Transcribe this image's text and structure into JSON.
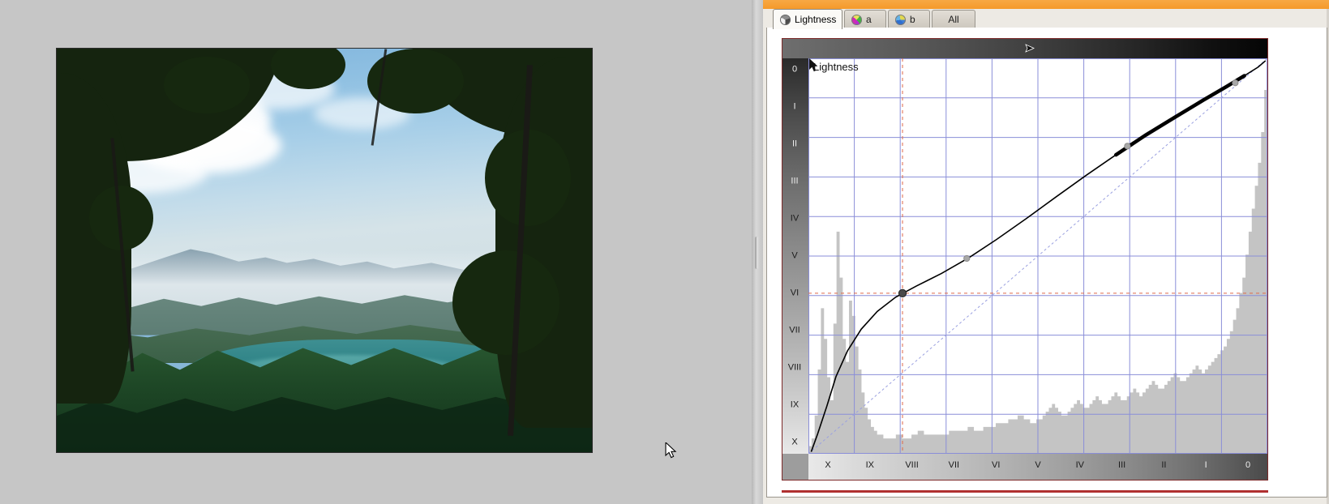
{
  "window": {
    "accent_color": "#f59a2b",
    "canvas_background": "#c6c6c6"
  },
  "image_view": {
    "name": "photo-canvas",
    "description": "Landscape photograph of a lake surrounded by forested hills, framed by dark tree foliage"
  },
  "tabs": [
    {
      "id": "lightness",
      "label": "Lightness",
      "icon": "lightness-wheel-icon",
      "active": true
    },
    {
      "id": "a",
      "label": "a",
      "icon": "a-channel-wheel-icon",
      "active": false
    },
    {
      "id": "b",
      "label": "b",
      "icon": "b-channel-wheel-icon",
      "active": false
    },
    {
      "id": "all",
      "label": "All",
      "icon": "",
      "active": false
    }
  ],
  "curve_panel": {
    "channel_label": "Lightness",
    "y_axis_labels": [
      "0",
      "I",
      "II",
      "III",
      "IV",
      "V",
      "VI",
      "VII",
      "VIII",
      "IX",
      "X"
    ],
    "x_axis_labels": [
      "X",
      "IX",
      "VIII",
      "VII",
      "VI",
      "V",
      "IV",
      "III",
      "II",
      "I",
      "0"
    ],
    "grid_color": "#8a8ed8",
    "curve_color": "#000000",
    "identity_line_color": "#9aa0e0",
    "crosshair_color": "#e06a4a",
    "histogram_color": "#c4c4c4",
    "selected_point_color": "#4a4a4a",
    "control_point_color": "#a8a8a8",
    "highlight_color": "#b03030"
  },
  "chart_data": {
    "type": "line",
    "title": "Lightness",
    "xlabel": "",
    "ylabel": "",
    "xlim": [
      0,
      100
    ],
    "ylim": [
      0,
      100
    ],
    "grid": true,
    "x_tick_labels": [
      "X",
      "IX",
      "VIII",
      "VII",
      "VI",
      "V",
      "IV",
      "III",
      "II",
      "I",
      "0"
    ],
    "y_tick_labels": [
      "0",
      "I",
      "II",
      "III",
      "IV",
      "V",
      "VI",
      "VII",
      "VIII",
      "IX",
      "X"
    ],
    "series": [
      {
        "name": "Tone curve",
        "type": "line",
        "points": [
          [
            0.6,
            0.5
          ],
          [
            2.0,
            5.0
          ],
          [
            4.0,
            12.0
          ],
          [
            6.0,
            19.5
          ],
          [
            8.5,
            26.0
          ],
          [
            11.5,
            31.5
          ],
          [
            15.0,
            36.0
          ],
          [
            19.0,
            39.6
          ],
          [
            23.5,
            42.4
          ],
          [
            29.0,
            45.6
          ],
          [
            35.0,
            49.6
          ],
          [
            41.0,
            54.2
          ],
          [
            47.5,
            59.5
          ],
          [
            54.0,
            65.0
          ],
          [
            60.5,
            70.4
          ],
          [
            67.0,
            75.6
          ],
          [
            73.5,
            80.6
          ],
          [
            80.0,
            85.2
          ],
          [
            86.0,
            89.4
          ],
          [
            91.0,
            92.8
          ],
          [
            95.0,
            95.6
          ],
          [
            98.0,
            97.8
          ],
          [
            99.6,
            99.4
          ]
        ]
      },
      {
        "name": "Identity diagonal",
        "type": "line",
        "style": "dashed",
        "points": [
          [
            0,
            0
          ],
          [
            100,
            100
          ]
        ]
      }
    ],
    "control_points": [
      {
        "x": 0.6,
        "y": 0.4,
        "state": "endpoint"
      },
      {
        "x": 20.5,
        "y": 40.6,
        "state": "selected"
      },
      {
        "x": 34.5,
        "y": 49.4,
        "state": "normal"
      },
      {
        "x": 69.5,
        "y": 77.8,
        "state": "normal"
      },
      {
        "x": 93.0,
        "y": 93.8,
        "state": "normal"
      },
      {
        "x": 99.5,
        "y": 99.5,
        "state": "endpoint"
      }
    ],
    "highlighted_segment": {
      "from": 69.5,
      "to": 93.0
    },
    "crosshair": {
      "x": 20.5,
      "y": 40.6
    },
    "histogram": {
      "name": "Input histogram",
      "bins": [
        2,
        4,
        10,
        22,
        38,
        30,
        20,
        14,
        34,
        58,
        46,
        30,
        24,
        40,
        36,
        28,
        22,
        16,
        12,
        9,
        7,
        6,
        5,
        5,
        4,
        4,
        4,
        4,
        5,
        5,
        4,
        4,
        4,
        5,
        5,
        6,
        6,
        5,
        5,
        5,
        5,
        5,
        5,
        5,
        5,
        6,
        6,
        6,
        6,
        6,
        6,
        7,
        7,
        6,
        6,
        6,
        7,
        7,
        7,
        7,
        8,
        8,
        8,
        8,
        9,
        9,
        9,
        10,
        10,
        9,
        9,
        8,
        8,
        9,
        9,
        10,
        11,
        12,
        13,
        12,
        11,
        10,
        10,
        11,
        12,
        13,
        14,
        13,
        12,
        12,
        13,
        14,
        15,
        14,
        13,
        13,
        14,
        15,
        16,
        15,
        14,
        14,
        15,
        16,
        17,
        16,
        15,
        16,
        17,
        18,
        19,
        18,
        17,
        17,
        18,
        19,
        20,
        21,
        20,
        19,
        19,
        20,
        21,
        22,
        23,
        22,
        21,
        22,
        23,
        24,
        25,
        26,
        27,
        28,
        30,
        32,
        35,
        38,
        42,
        46,
        52,
        58,
        64,
        70,
        76,
        84,
        95
      ]
    }
  }
}
